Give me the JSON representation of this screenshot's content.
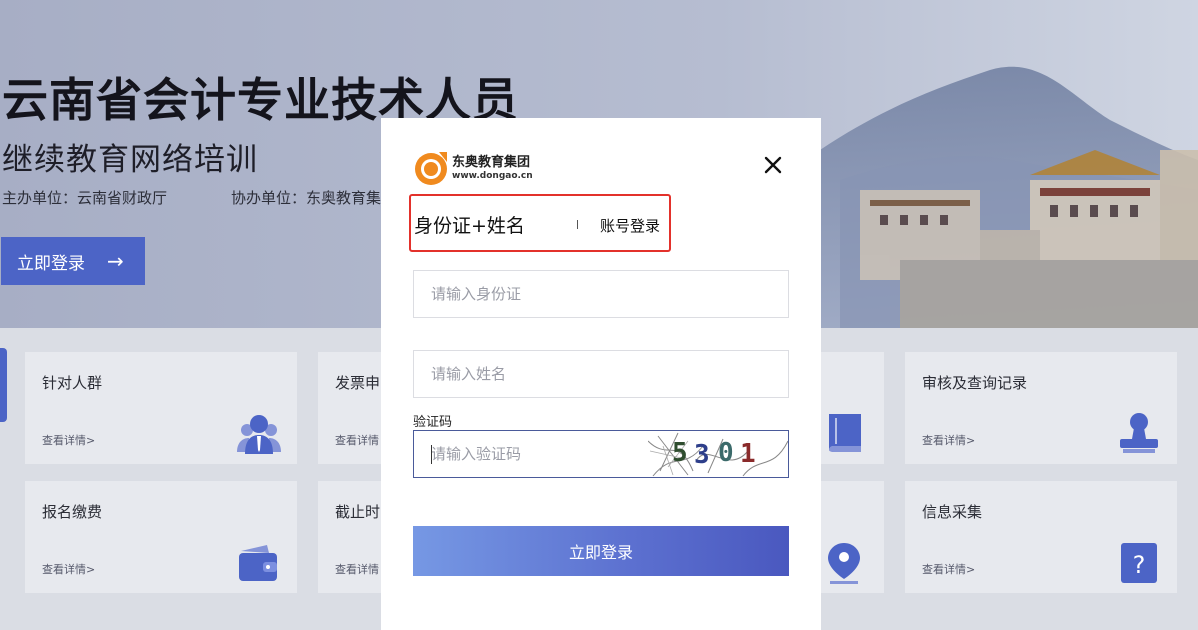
{
  "hero": {
    "title": "云南省会计专业技术人员",
    "subtitle": "继续教育网络培训",
    "organizer": "主办单位：云南省财政厅",
    "co_organizer": "协办单位：东奥教育集",
    "login_button": "立即登录",
    "login_arrow": "→"
  },
  "cards": [
    {
      "title": "针对人群",
      "link": "查看详情>",
      "icon": "user-group-icon"
    },
    {
      "title": "发票申",
      "link": "查看详情",
      "icon": ""
    },
    {
      "title": "",
      "link": "",
      "icon": "book-icon"
    },
    {
      "title": "审核及查询记录",
      "link": "查看详情>",
      "icon": "stamp-icon"
    },
    {
      "title": "报名缴费",
      "link": "查看详情>",
      "icon": "wallet-icon"
    },
    {
      "title": "截止时",
      "link": "查看详情",
      "icon": ""
    },
    {
      "title": "",
      "link": "",
      "icon": "location-pin-icon"
    },
    {
      "title": "信息采集",
      "link": "查看详情>",
      "icon": "question-icon"
    }
  ],
  "modal": {
    "logo_name": "东奥教育集团",
    "logo_url": "www.dongao.cn",
    "tab_id_name": "身份证+姓名",
    "tab_account": "账号登录",
    "id_placeholder": "请输入身份证",
    "name_placeholder": "请输入姓名",
    "captcha_label": "验证码",
    "captcha_placeholder": "请输入验证码",
    "captcha_text": "5301",
    "submit_label": "立即登录"
  },
  "colors": {
    "accent": "#4c64c6",
    "highlight_border": "#e3312b",
    "logo_orange": "#f08a1e"
  }
}
